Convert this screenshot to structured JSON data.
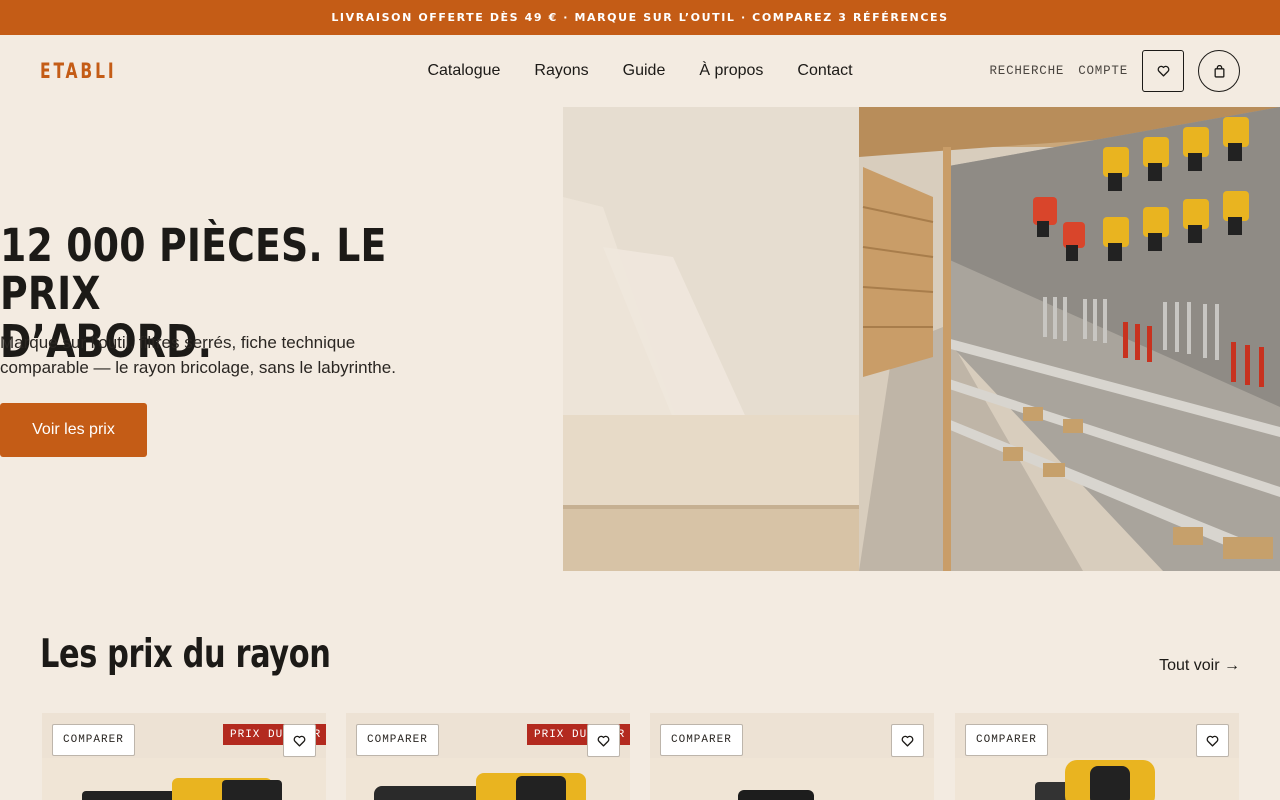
{
  "promo_bar": {
    "text": "LIVRAISON OFFERTE DÈS 49 € · MARQUE SUR L’OUTIL · COMPAREZ 3 RÉFÉRENCES"
  },
  "header": {
    "logo": "ETABLI",
    "nav": [
      "Catalogue",
      "Rayons",
      "Guide",
      "À propos",
      "Contact"
    ],
    "search_label": "RECHERCHE",
    "account_label": "COMPTE",
    "wishlist_icon": "heart-icon",
    "cart_icon": "bag-icon"
  },
  "hero": {
    "title_line1": "12 000 PIÈCES. LE PRIX",
    "title_line2": "D’ABORD.",
    "subtitle": "Marque sur l’outil, filtres serrés, fiche technique comparable — le rayon bricolage, sans le labyrinthe.",
    "cta": "Voir les prix"
  },
  "section": {
    "title": "Les prix du rayon",
    "see_all": "Tout voir →"
  },
  "cards": [
    {
      "compare": "COMPARER",
      "tag": "PRIX DU JOUR",
      "fav_icon": "heart-icon"
    },
    {
      "compare": "COMPARER",
      "tag": "PRIX DU JOUR",
      "fav_icon": "heart-icon"
    },
    {
      "compare": "COMPARER",
      "tag": "",
      "fav_icon": "heart-icon"
    },
    {
      "compare": "COMPARER",
      "tag": "",
      "fav_icon": "heart-icon"
    }
  ],
  "colors": {
    "accent": "#c45c16",
    "background": "#f3ebe1",
    "sale": "#b32a1f",
    "text": "#1c1a17"
  }
}
